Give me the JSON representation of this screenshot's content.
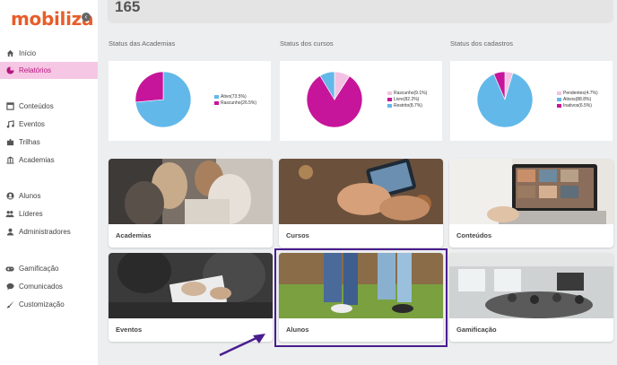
{
  "app": {
    "logo": "mobiliza",
    "collapse_icon": "chevron-left-icon"
  },
  "sidebar": {
    "items": [
      {
        "label": "Início",
        "icon": "home-icon"
      },
      {
        "label": "Relatórios",
        "icon": "pie-chart-icon",
        "active": true
      },
      {
        "label": "Conteúdos",
        "icon": "content-icon"
      },
      {
        "label": "Eventos",
        "icon": "music-icon"
      },
      {
        "label": "Trilhas",
        "icon": "puzzle-icon"
      },
      {
        "label": "Academias",
        "icon": "building-icon"
      },
      {
        "label": "Alunos",
        "icon": "user-icon"
      },
      {
        "label": "Líderes",
        "icon": "users-icon"
      },
      {
        "label": "Administradores",
        "icon": "admin-icon"
      },
      {
        "label": "Gamificação",
        "icon": "gamepad-icon"
      },
      {
        "label": "Comunicados",
        "icon": "chat-icon"
      },
      {
        "label": "Customização",
        "icon": "brush-icon"
      }
    ]
  },
  "summary": {
    "value": "165"
  },
  "charts": {
    "academias": {
      "title": "Status das Academias"
    },
    "cursos": {
      "title": "Status dos cursos"
    },
    "cadastros": {
      "title": "Status dos cadastros"
    }
  },
  "chart_data": [
    {
      "type": "pie",
      "title": "Status das Academias",
      "categories": [
        "Ativo(73.5%)",
        "Rascunho(26.5%)"
      ],
      "values": [
        73.5,
        26.5
      ],
      "colors": [
        "#63b8ea",
        "#c6159a"
      ]
    },
    {
      "type": "pie",
      "title": "Status dos cursos",
      "categories": [
        "Rascunho(9.1%)",
        "Livre(82.2%)",
        "Restrito(8.7%)"
      ],
      "values": [
        9.1,
        82.2,
        8.7
      ],
      "colors": [
        "#f3c2e3",
        "#c6159a",
        "#63b8ea"
      ]
    },
    {
      "type": "pie",
      "title": "Status dos cadastros",
      "categories": [
        "Pendentes(4.7%)",
        "Ativos(88.8%)",
        "Inativos(6.5%)"
      ],
      "values": [
        4.7,
        88.8,
        6.5
      ],
      "colors": [
        "#f3c2e3",
        "#63b8ea",
        "#c6159a"
      ]
    }
  ],
  "cards": [
    {
      "label": "Academias"
    },
    {
      "label": "Cursos"
    },
    {
      "label": "Conteúdos"
    },
    {
      "label": "Eventos"
    },
    {
      "label": "Alunos"
    },
    {
      "label": "Gamificação"
    }
  ],
  "colors": {
    "brand": "#e85d2a",
    "active_bg": "#f6c7e4",
    "active_text": "#b6157d",
    "highlight": "#4a1d8f"
  }
}
